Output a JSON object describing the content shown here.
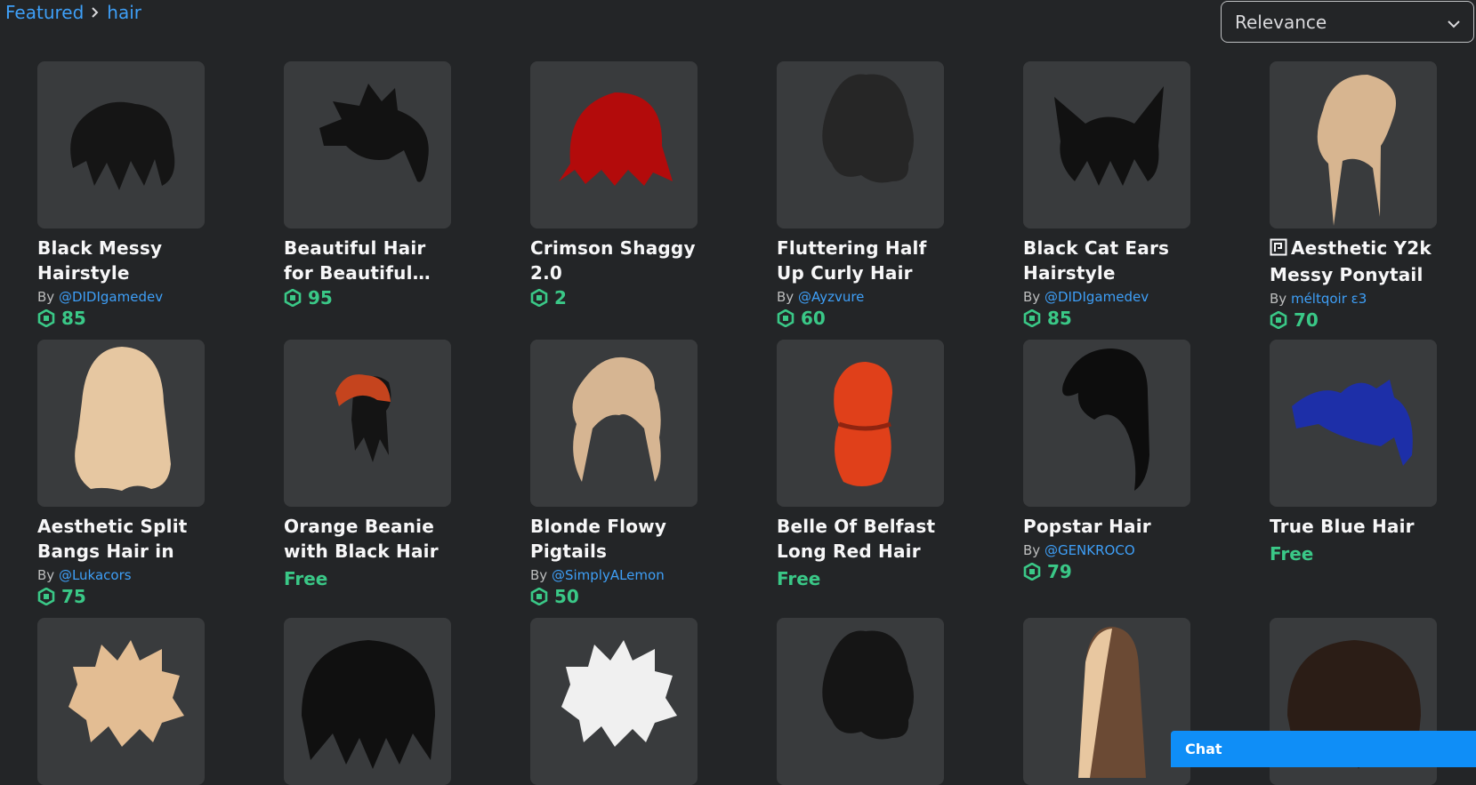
{
  "breadcrumb": {
    "featured": "Featured",
    "current": "hair"
  },
  "sort": {
    "selected": "Relevance"
  },
  "by_label": "By",
  "items": [
    {
      "name": "Black Messy Hairstyle",
      "creator": "@DIDIgamedev",
      "price": "85",
      "hair": "#151515",
      "style": "messy"
    },
    {
      "name": "Beautiful Hair for Beautiful People",
      "creator": "",
      "price": "95",
      "hair": "#121212",
      "style": "spiky"
    },
    {
      "name": "Crimson Shaggy 2.0",
      "creator": "",
      "price": "2",
      "hair": "#b30b0b",
      "style": "bob"
    },
    {
      "name": "Fluttering Half Up Curly Hair",
      "creator": "@Ayzvure",
      "price": "60",
      "hair": "#262626",
      "style": "curly"
    },
    {
      "name": "Black Cat Ears Hairstyle",
      "creator": "@DIDIgamedev",
      "price": "85",
      "hair": "#111111",
      "style": "catears"
    },
    {
      "name": "Aesthetic Y2k Messy Ponytail",
      "creator": "méltqoir ε3",
      "price": "70",
      "hair": "#d7b590",
      "style": "ponytail",
      "limited": true
    },
    {
      "name": "Aesthetic Split Bangs Hair in",
      "creator": "@Lukacors",
      "price": "75",
      "hair": "#e6c7a1",
      "style": "long"
    },
    {
      "name": "Orange Beanie with Black Hair",
      "creator": "",
      "price": "Free",
      "hair": "#141414",
      "style": "beanie"
    },
    {
      "name": "Blonde Flowy Pigtails",
      "creator": "@SimplyALemon",
      "price": "50",
      "hair": "#d6b592",
      "style": "pigtails"
    },
    {
      "name": "Belle Of Belfast Long Red Hair",
      "creator": "",
      "price": "Free",
      "hair": "#e0401a",
      "style": "braid"
    },
    {
      "name": "Popstar Hair",
      "creator": "@GENKROCO",
      "price": "79",
      "hair": "#0d0d0d",
      "style": "straight"
    },
    {
      "name": "True Blue Hair",
      "creator": "",
      "price": "Free",
      "hair": "#1d2fa8",
      "style": "swept"
    },
    {
      "name": "",
      "creator": "",
      "price": "",
      "hair": "#e3bd93",
      "style": "fluffy"
    },
    {
      "name": "",
      "creator": "",
      "price": "",
      "hair": "#101010",
      "style": "bowl"
    },
    {
      "name": "",
      "creator": "",
      "price": "",
      "hair": "#f0f0f0",
      "style": "fluffy"
    },
    {
      "name": "",
      "creator": "",
      "price": "",
      "hair": "#151515",
      "style": "curly"
    },
    {
      "name": "",
      "creator": "",
      "price": "",
      "hair": "#6b4a34",
      "style": "twotone"
    },
    {
      "name": "",
      "creator": "",
      "price": "",
      "hair": "#2b1d16",
      "style": "bowl"
    }
  ],
  "chat": {
    "label": "Chat"
  },
  "colors": {
    "accent": "#3e9ff7",
    "price": "#3ac887",
    "background": "#232527",
    "card": "#393b3d"
  }
}
